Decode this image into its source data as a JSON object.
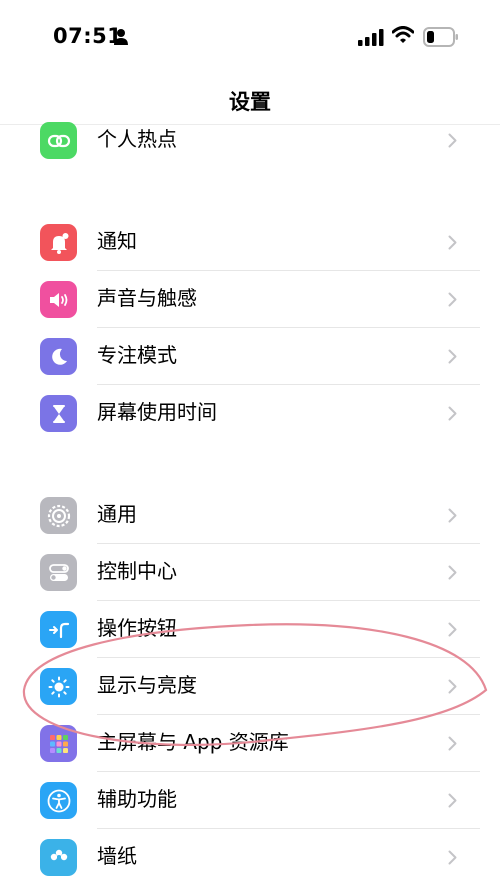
{
  "status_bar": {
    "time": "07:51"
  },
  "nav": {
    "title": "设置"
  },
  "groups": [
    {
      "items": [
        {
          "label": "个人热点",
          "icon": "hotspot-icon",
          "color": "#4cd964"
        }
      ]
    },
    {
      "items": [
        {
          "label": "通知",
          "icon": "bell-icon",
          "color": "#f2545b"
        },
        {
          "label": "声音与触感",
          "icon": "speaker-icon",
          "color": "#f0509f"
        },
        {
          "label": "专注模式",
          "icon": "moon-icon",
          "color": "#7b74e6"
        },
        {
          "label": "屏幕使用时间",
          "icon": "hourglass-icon",
          "color": "#7b74e6"
        }
      ]
    },
    {
      "items": [
        {
          "label": "通用",
          "icon": "gear-icon",
          "color": "#b8b8be"
        },
        {
          "label": "控制中心",
          "icon": "toggles-icon",
          "color": "#b8b8be"
        },
        {
          "label": "操作按钮",
          "icon": "action-button-icon",
          "color": "#2aa5f5"
        },
        {
          "label": "显示与亮度",
          "icon": "sun-icon",
          "color": "#2aa5f5"
        },
        {
          "label": "主屏幕与 App 资源库",
          "icon": "app-grid-icon",
          "color": "#8172e8"
        },
        {
          "label": "辅助功能",
          "icon": "accessibility-icon",
          "color": "#2aa5f5"
        },
        {
          "label": "墙纸",
          "icon": "wallpaper-icon",
          "color": "#3bb2e8"
        }
      ]
    }
  ],
  "annotation": {
    "color": "#e58a97"
  }
}
